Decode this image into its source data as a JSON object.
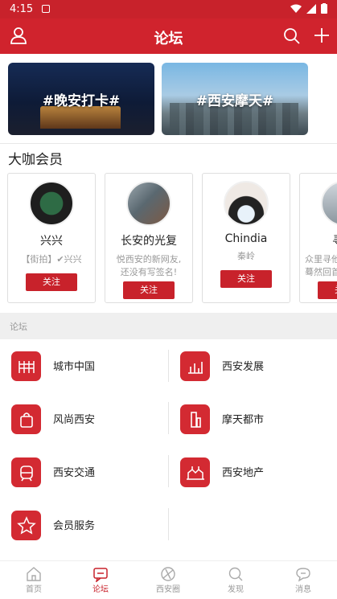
{
  "status": {
    "time": "4:15"
  },
  "app": {
    "title": "论坛"
  },
  "banners": [
    {
      "label": "#晚安打卡#"
    },
    {
      "label": "#西安摩天#"
    }
  ],
  "members_section": {
    "title": "大咖会员"
  },
  "members": [
    {
      "name": "兴兴",
      "desc": "【街拍】✔兴兴",
      "follow": "关注"
    },
    {
      "name": "长安的光复",
      "desc": "悦西安的新网友,\n还没有写签名!",
      "follow": "关注"
    },
    {
      "name": "Chindia",
      "desc": "秦岭",
      "follow": "关注"
    },
    {
      "name": "寻他",
      "desc": "众里寻他\n蓦然回首",
      "follow": "关注"
    }
  ],
  "forum_section": {
    "label": "论坛"
  },
  "forums": [
    {
      "label": "城市中国",
      "icon": "city-icon"
    },
    {
      "label": "西安发展",
      "icon": "chart-icon"
    },
    {
      "label": "风尚西安",
      "icon": "bag-icon"
    },
    {
      "label": "摩天都市",
      "icon": "tower-icon"
    },
    {
      "label": "西安交通",
      "icon": "car-icon"
    },
    {
      "label": "西安地产",
      "icon": "building-icon"
    },
    {
      "label": "会员服务",
      "icon": "star-icon"
    }
  ],
  "tabs": [
    {
      "label": "首页",
      "icon": "home-icon"
    },
    {
      "label": "论坛",
      "icon": "forum-icon",
      "active": true
    },
    {
      "label": "西安圈",
      "icon": "circle-icon"
    },
    {
      "label": "发现",
      "icon": "discover-icon"
    },
    {
      "label": "消息",
      "icon": "message-icon"
    }
  ],
  "colors": {
    "primary": "#d0232d",
    "icon_bg": "#d32a32"
  }
}
